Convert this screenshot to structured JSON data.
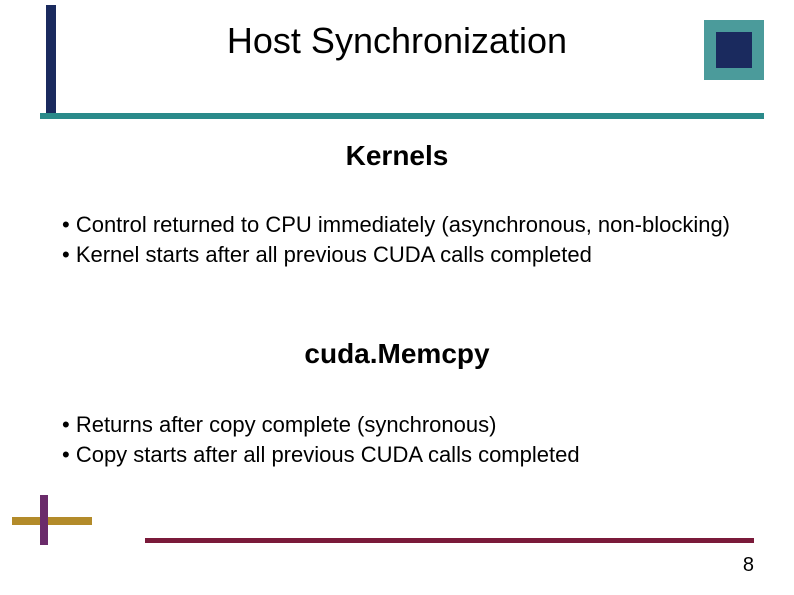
{
  "title": "Host Synchronization",
  "section1": {
    "heading": "Kernels",
    "bullets": [
      "• Control returned to CPU immediately (asynchronous, non-blocking)",
      "• Kernel starts after all previous CUDA calls completed"
    ]
  },
  "section2": {
    "heading": "cuda.Memcpy",
    "bullets": [
      "• Returns after copy complete (synchronous)",
      "• Copy starts after all previous CUDA calls completed"
    ]
  },
  "page_number": "8",
  "colors": {
    "teal": "#2a8a8a",
    "navy": "#1a2a5e",
    "maroon": "#7a1a3a",
    "gold": "#b38b2a",
    "purple": "#6b2b6b"
  }
}
